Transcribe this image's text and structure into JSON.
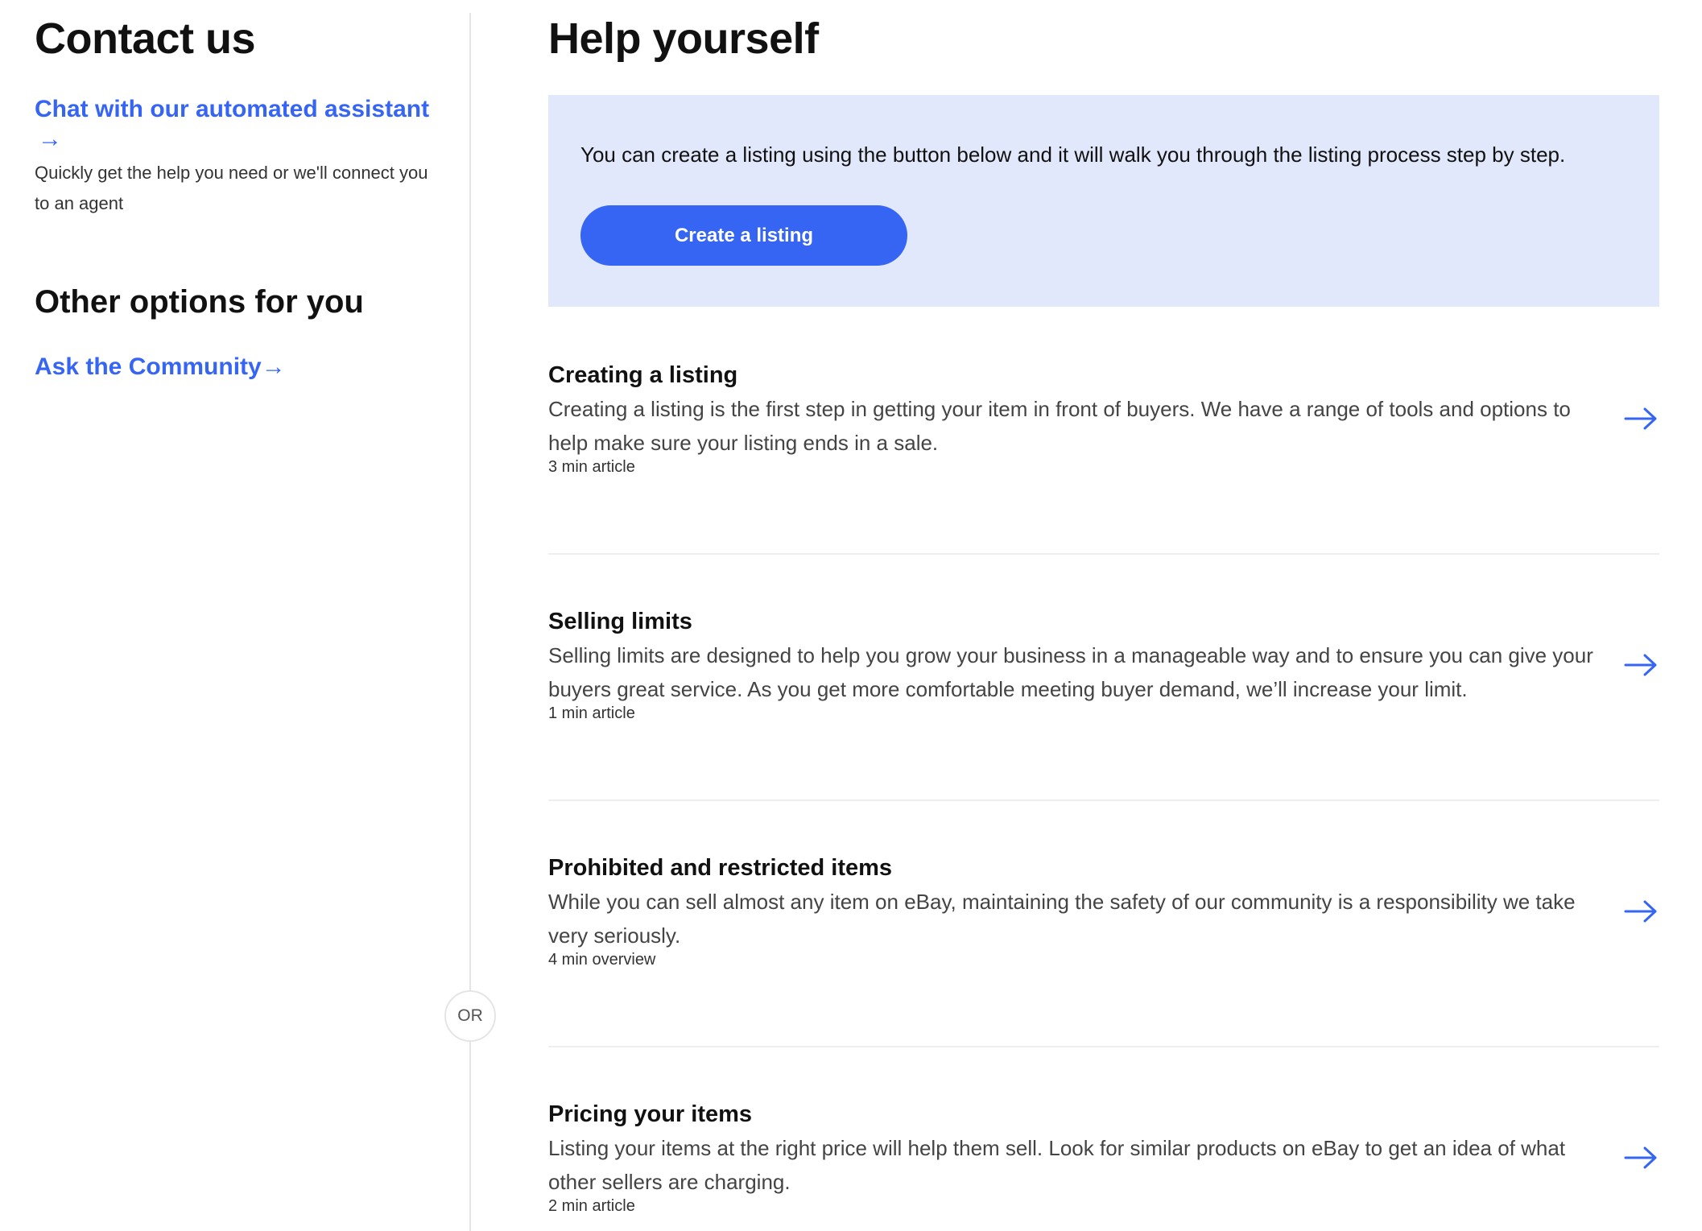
{
  "contact": {
    "title": "Contact us",
    "chat_link": "Chat with our automated assistant",
    "chat_arrow": "→",
    "chat_description": "Quickly get the help you need or we'll connect you to an agent",
    "other_title": "Other options for you",
    "community_link": "Ask the Community",
    "community_arrow": "→"
  },
  "divider": {
    "or_label": "OR"
  },
  "help": {
    "title": "Help yourself",
    "promo_text": "You can create a listing using the button below and it will walk you through the listing process step by step.",
    "promo_button": "Create a listing",
    "articles": [
      {
        "title": "Creating a listing",
        "description": "Creating a listing is the first step in getting your item in front of buyers. We have a range of tools and options to help make sure your listing ends in a sale.",
        "meta": "3 min article",
        "icon": "arrow-right-icon"
      },
      {
        "title": "Selling limits",
        "description": "Selling limits are designed to help you grow your business in a manageable way and to ensure you can give your buyers great service. As you get more comfortable meeting buyer demand, we’ll increase your limit.",
        "meta": "1 min article",
        "icon": "arrow-right-icon"
      },
      {
        "title": "Prohibited and restricted items",
        "description": "While you can sell almost any item on eBay, maintaining the safety of our community is a responsibility we take very seriously.",
        "meta": "4 min overview",
        "icon": "arrow-right-icon"
      },
      {
        "title": "Pricing your items",
        "description": "Listing your items at the right price will help them sell. Look for similar products on eBay to get an idea of what other sellers are charging.",
        "meta": "2 min article",
        "icon": "arrow-right-icon"
      }
    ]
  },
  "colors": {
    "link": "#3665f3",
    "promo_background": "#e2e8fb",
    "button": "#3665f3"
  }
}
